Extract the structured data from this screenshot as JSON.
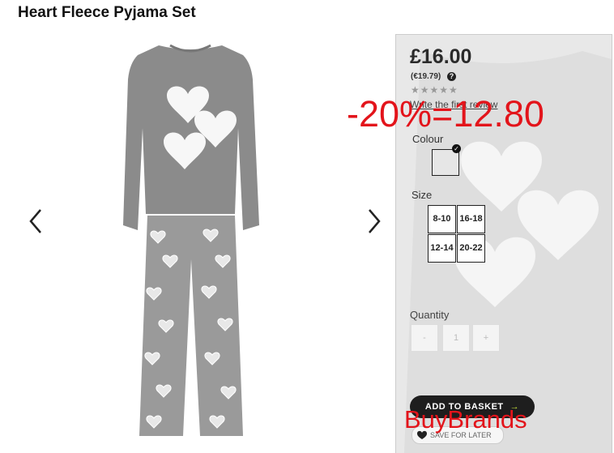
{
  "product": {
    "title": "Heart Fleece Pyjama Set"
  },
  "gallery": {
    "prev_icon": "chevron-left-icon",
    "next_icon": "chevron-right-icon"
  },
  "buy_panel": {
    "price": "£16.00",
    "alt_price": "(€19.79)",
    "help_icon_text": "?",
    "rating_stars": "★★★★★",
    "review_link": "Write the first review",
    "colour_label": "Colour",
    "selected_check": "✓",
    "size_label": "Size",
    "sizes": [
      "8-10",
      "16-18",
      "12-14",
      "20-22"
    ],
    "quantity_label": "Quantity",
    "qty_minus": "-",
    "qty_value": "1",
    "qty_plus": "+",
    "add_to_basket": "ADD TO BASKET",
    "add_arrow": "→",
    "save_for_later": "SAVE FOR LATER"
  },
  "overlay": {
    "promo_text": "-20%=12.80",
    "brand_text": "BuyBrands",
    "overlay_color": "#e3141b"
  }
}
